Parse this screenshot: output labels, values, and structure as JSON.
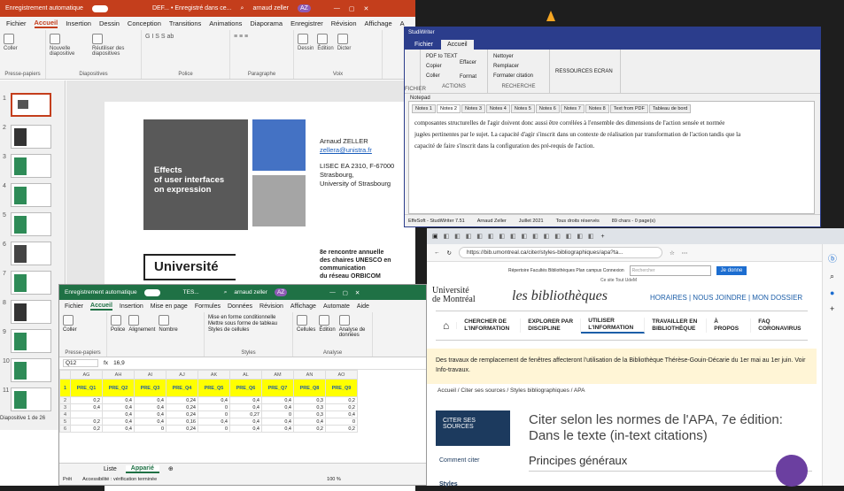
{
  "ppt": {
    "title": "Enregistrement automatique",
    "doc": "DEF... • Enregistré dans ce...",
    "user": "arnaud zeller",
    "initials": "AZ",
    "menus": [
      "Fichier",
      "Accueil",
      "Insertion",
      "Dessin",
      "Conception",
      "Transitions",
      "Animations",
      "Diaporama",
      "Enregistrer",
      "Révision",
      "Affichage",
      "A"
    ],
    "ribbon": {
      "clipboard": {
        "paste": "Coller",
        "label": "Presse-papiers"
      },
      "slides": {
        "new": "Nouvelle diapositive",
        "reuse": "Réutiliser des diapositives",
        "label": "Diapositives"
      },
      "font": {
        "label": "Police"
      },
      "paragraph": {
        "label": "Paragraphe"
      },
      "draw": {
        "draw": "Dessin",
        "edit": "Édition",
        "dictate": "Dicter",
        "label": "Voix"
      }
    },
    "thumbs": [
      "1",
      "2",
      "3",
      "4",
      "5",
      "6",
      "7",
      "8",
      "9",
      "10",
      "11"
    ],
    "status": "Diapositive 1 de 26",
    "slide": {
      "effects_line1": "Effects",
      "effects_line2": "of user interfaces",
      "effects_line3": "on expression",
      "author": "Arnaud ZELLER",
      "email": "zellera@unistra.fr",
      "lab": "LISEC EA 2310, F-67000",
      "city": "Strasbourg,",
      "univ": "University of Strasbourg",
      "universite": "Université",
      "event1": "8e rencontre annuelle",
      "event2": "des chaires UNESCO en",
      "event3": "communication",
      "event4": "du réseau ORBICOM"
    }
  },
  "sw": {
    "title": "StudiWriter",
    "tabs": [
      "Fichier",
      "Accueil"
    ],
    "actions": {
      "pdf": "PDF to TEXT",
      "copy": "Copier",
      "paste": "Coller",
      "erase": "Effacer",
      "format": "Format",
      "label": "ACTIONS"
    },
    "search": {
      "clean": "Nettoyer",
      "replace": "Remplacer",
      "fmtcite": "Formater citation",
      "label": "RECHERCHE"
    },
    "res": {
      "resources": "RESSOURCES",
      "screen": "ECRAN"
    },
    "fichier_label": "FICHIER",
    "notepad_tab": "Notepad",
    "notes": [
      "Notes 1",
      "Notes 2",
      "Notes 3",
      "Notes 4",
      "Notes 5",
      "Notes 6",
      "Notes 7",
      "Notes 8",
      "Text from PDF",
      "Tableau de bord"
    ],
    "text1": "composantes structurelles de l'agir doivent donc aussi être corrélées à l'ensemble des dimensions de l'action sensée et normée",
    "text2": "jugées pertinentes par le sujet. La capacité d'agir s'inscrit dans un contexte de réalisation par transformation de l'action tandis que la",
    "text3": "capacité de faire s'inscrit dans la configuration des pré-requis de l'action.",
    "status": [
      "EffeSoft - StudiWriter 7.51",
      "Arnaud Zeller",
      "Juillet 2021",
      "Tous droits réservés",
      "89 chars - 0 page(s)"
    ]
  },
  "xl": {
    "title": "Enregistrement automatique",
    "doc": "TES...",
    "user": "arnaud zeller",
    "initials": "AZ",
    "menus": [
      "Fichier",
      "Accueil",
      "Insertion",
      "Mise en page",
      "Formules",
      "Données",
      "Révision",
      "Affichage",
      "Automate",
      "Aide"
    ],
    "ribbon": {
      "paste": "Coller",
      "font": "Police",
      "align": "Alignement",
      "number": "Nombre",
      "cond": "Mise en forme conditionnelle",
      "table": "Mettre sous forme de tableau",
      "styles": "Styles de cellules",
      "styles_label": "Styles",
      "cells": "Cellules",
      "edit": "Édition",
      "analyze": "Analyse de données",
      "analyse_label": "Analyse",
      "clip_label": "Presse-papiers"
    },
    "cellref": "Q12",
    "formula": "16,9",
    "cols": [
      "AG",
      "AH",
      "AI",
      "AJ",
      "AK",
      "AL",
      "AM",
      "AN",
      "AO"
    ],
    "headers": [
      "PRE_Q1",
      "PRE_Q2",
      "PRE_Q3",
      "PRE_Q4",
      "PRE_Q5",
      "PRE_Q6",
      "PRE_Q7",
      "PRE_Q8",
      "PRE_Q9"
    ],
    "rows": [
      [
        "0,2",
        "0,4",
        "0,4",
        "0,24",
        "0,4",
        "0,4",
        "0,4",
        "0,3",
        "0,2"
      ],
      [
        "0,4",
        "0,4",
        "0,4",
        "0,24",
        "0",
        "0,4",
        "0,4",
        "0,3",
        "0,2"
      ],
      [
        "",
        "0,4",
        "0,4",
        "0,24",
        "0",
        "0,27",
        "0",
        "0,3",
        "0,4"
      ],
      [
        "0,2",
        "0,4",
        "0,4",
        "0,16",
        "0,4",
        "0,4",
        "0,4",
        "0,4",
        "0"
      ],
      [
        "0,2",
        "0,4",
        "0",
        "0,24",
        "0",
        "0,4",
        "0,4",
        "0,2",
        "0,2"
      ]
    ],
    "sheets": [
      "Liste",
      "Apparié"
    ],
    "status": [
      "Prêt",
      "Accessibilité : vérification terminée",
      "100 %"
    ]
  },
  "edge": {
    "url": "https://bib.umontreal.ca/citer/styles-bibliographiques/apa?ta...",
    "udm": {
      "toplinks": "Répertoire  Facultés  Bibliothèques  Plan campus  Connexion",
      "search_ph": "Rechercher",
      "je": "Je donne",
      "radio": "Ce site   Tout UdeM",
      "univ1": "Université",
      "univ2": "de Montréal",
      "bib": "les bibliothèques",
      "links": "HORAIRES | NOUS JOINDRE | MON DOSSIER",
      "nav": [
        "CHERCHER DE L'INFORMATION",
        "EXPLORER PAR DISCIPLINE",
        "UTILISER L'INFORMATION",
        "TRAVAILLER EN BIBLIOTHÈQUE",
        "À PROPOS",
        "FAQ CORONAVIRUS"
      ],
      "banner": "Des travaux de remplacement de fenêtres affecteront l'utilisation de la Bibliothèque Thérèse-Gouin-Décarie du 1er mai au 1er juin. Voir Info-travaux.",
      "crumbs": "Accueil / Citer ses sources / Styles bibliographiques / APA",
      "cite": "CITER SES SOURCES",
      "h1": "Citer selon les normes de l'APA, 7e édition: Dans le texte (in-text citations)",
      "side1": "Comment citer",
      "side2": "Styles",
      "h2": "Principes généraux"
    }
  }
}
